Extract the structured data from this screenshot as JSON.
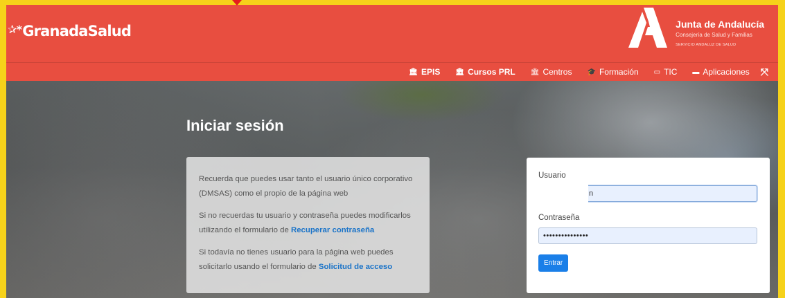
{
  "header": {
    "brand": "GranadaSalud",
    "junta_title": "Junta de Andalucía",
    "junta_sub": "Consejería de Salud y Familias",
    "junta_small": "SERVICIO ANDALUZ DE SALUD"
  },
  "nav": {
    "items": [
      {
        "label": "EPIS",
        "icon": "building-icon",
        "bold": true
      },
      {
        "label": "Cursos PRL",
        "icon": "building-icon",
        "bold": true
      },
      {
        "label": "Centros",
        "icon": "building-icon",
        "bold": false
      },
      {
        "label": "Formación",
        "icon": "graduation-cap-icon",
        "bold": false
      },
      {
        "label": "TIC",
        "icon": "monitor-icon",
        "bold": false
      },
      {
        "label": "Aplicaciones",
        "icon": "window-icon",
        "bold": false
      }
    ]
  },
  "page": {
    "title": "Iniciar sesión"
  },
  "info": {
    "p1": "Recuerda que puedes usar tanto el usuario único corporativo (DMSAS) como el propio de la página web",
    "p2_text": "Si no recuerdas tu usuario y contraseña puedes modificarlos utilizando el formulario de ",
    "p2_link": "Recuperar contraseña",
    "p3_text": "Si todavía no tienes usuario para la página web puedes solicitarlo usando el formulario de ",
    "p3_link": "Solicitud de acceso"
  },
  "login": {
    "user_label": "Usuario",
    "user_value": "n",
    "pass_label": "Contraseña",
    "pass_value": "•••••••••••••••",
    "submit": "Entrar"
  },
  "colors": {
    "header": "#e84e40",
    "frame": "#f6d21a",
    "link": "#1a73c8",
    "button": "#1a7fe8"
  }
}
